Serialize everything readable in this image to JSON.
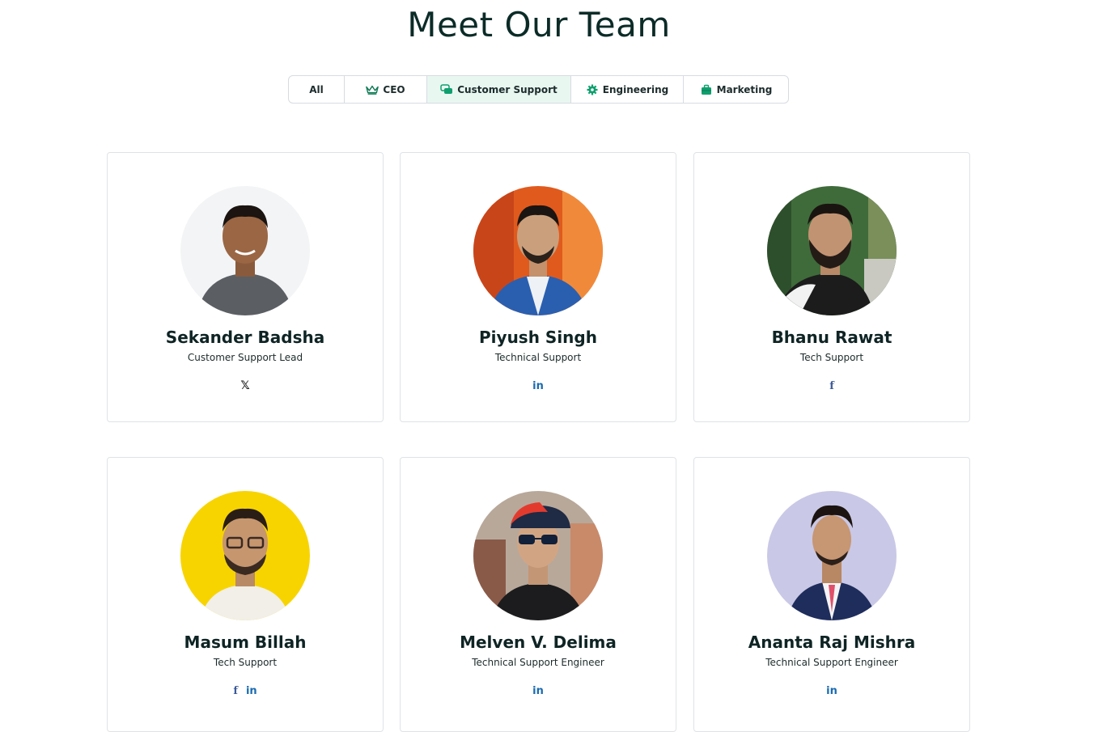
{
  "page": {
    "title": "Meet Our Team"
  },
  "tabs": [
    {
      "label": "All",
      "icon": "",
      "active": false
    },
    {
      "label": "CEO",
      "icon": "crown-icon",
      "active": false
    },
    {
      "label": "Customer Support",
      "icon": "chat-bubbles-icon",
      "active": true
    },
    {
      "label": "Engineering",
      "icon": "gear-icon",
      "active": false
    },
    {
      "label": "Marketing",
      "icon": "briefcase-icon",
      "active": false
    }
  ],
  "members": [
    {
      "name": "Sekander Badsha",
      "role": "Customer Support Lead",
      "socials": [
        "x"
      ]
    },
    {
      "name": "Piyush Singh",
      "role": "Technical Support",
      "socials": [
        "linkedin"
      ]
    },
    {
      "name": "Bhanu Rawat",
      "role": "Tech Support",
      "socials": [
        "facebook"
      ]
    },
    {
      "name": "Masum Billah",
      "role": "Tech Support",
      "socials": [
        "facebook",
        "linkedin"
      ]
    },
    {
      "name": "Melven V. Delima",
      "role": "Technical Support Engineer",
      "socials": [
        "linkedin"
      ]
    },
    {
      "name": "Ananta Raj Mishra",
      "role": "Technical Support Engineer",
      "socials": [
        "linkedin"
      ]
    }
  ],
  "colors": {
    "accent": "#0f9f6e",
    "active_tab_bg": "#e9f7f1",
    "linkedin": "#1a6bb0",
    "facebook": "#3b5998"
  }
}
